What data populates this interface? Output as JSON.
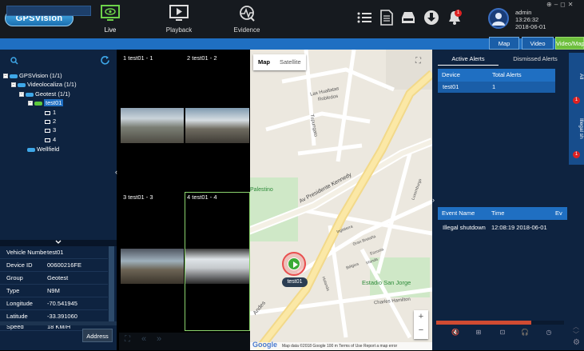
{
  "app": {
    "logo": "GPSVision"
  },
  "nav": [
    {
      "label": "Live",
      "icon": "monitor-icon",
      "active": true
    },
    {
      "label": "Playback",
      "icon": "play-screen-icon",
      "active": false
    },
    {
      "label": "Evidence",
      "icon": "evidence-icon",
      "active": false
    }
  ],
  "toolbar_icons": [
    "list-icon",
    "document-icon",
    "inbox-icon",
    "download-icon",
    "bell-icon"
  ],
  "alarm_badge": "1",
  "user": {
    "name": "admin",
    "time": "13:26:32",
    "date": "2018-06-01"
  },
  "window_controls": [
    "⊕",
    "–",
    "◻",
    "✕"
  ],
  "view_tabs": {
    "map": "Map",
    "video": "Video",
    "videomap": "Video/Map"
  },
  "tree": {
    "root": "GPSVision (1/1)",
    "company": "Videolocaliza (1/1)",
    "group": "Geotest (1/1)",
    "device": "test01",
    "channels": [
      "1",
      "2",
      "3",
      "4"
    ],
    "other": "Wellfield"
  },
  "vehicle_info": [
    {
      "k": "Vehicle Numbe",
      "v": "test01"
    },
    {
      "k": "Device ID",
      "v": "00600216FE"
    },
    {
      "k": "Group",
      "v": "Geotest"
    },
    {
      "k": "Type",
      "v": "N9M"
    },
    {
      "k": "Longitude",
      "v": "-70.541945"
    },
    {
      "k": "Latitude",
      "v": "-33.391060"
    },
    {
      "k": "Speed",
      "v": "18 KM/H"
    }
  ],
  "address_button": "Address",
  "video_cells": [
    "1 test01 - 1",
    "2 test01 - 2",
    "3 test01 - 3",
    "4 test01 - 4"
  ],
  "map": {
    "type_map": "Map",
    "type_sat": "Satellite",
    "streets": [
      "Las Hualtatas",
      "Av Presidente Kennedy",
      "Tupungato",
      "Robledos",
      "Estadio San Jorge",
      "Charles Hamilton",
      "Palestino",
      "Luxemburgo",
      "Inglaterra",
      "Gran Bretaña",
      "Escocia",
      "Irlanda",
      "Bélgica",
      "Holanda",
      "Andes"
    ],
    "marker_label": "test01",
    "attribution": "Map data ©2018 Google   100 m   Terms of Use   Report a map error",
    "google": "Google",
    "zoom_in": "+",
    "zoom_out": "−"
  },
  "alerts": {
    "tab_active": "Active Alerts",
    "tab_dismissed": "Dismissed Alerts",
    "cols": [
      "Device",
      "Total Alerts"
    ],
    "rows": [
      {
        "device": "test01",
        "total": "1"
      }
    ],
    "event_cols": [
      "Event Name",
      "Time",
      "Ev"
    ],
    "events": [
      {
        "name": "Illegal shutdown",
        "time": "12:08:19 2018-06-01"
      }
    ],
    "side_tab_all": "All",
    "side_tab_illegal": "Illegal sh",
    "side_badge1": "1",
    "side_badge2": "1"
  }
}
